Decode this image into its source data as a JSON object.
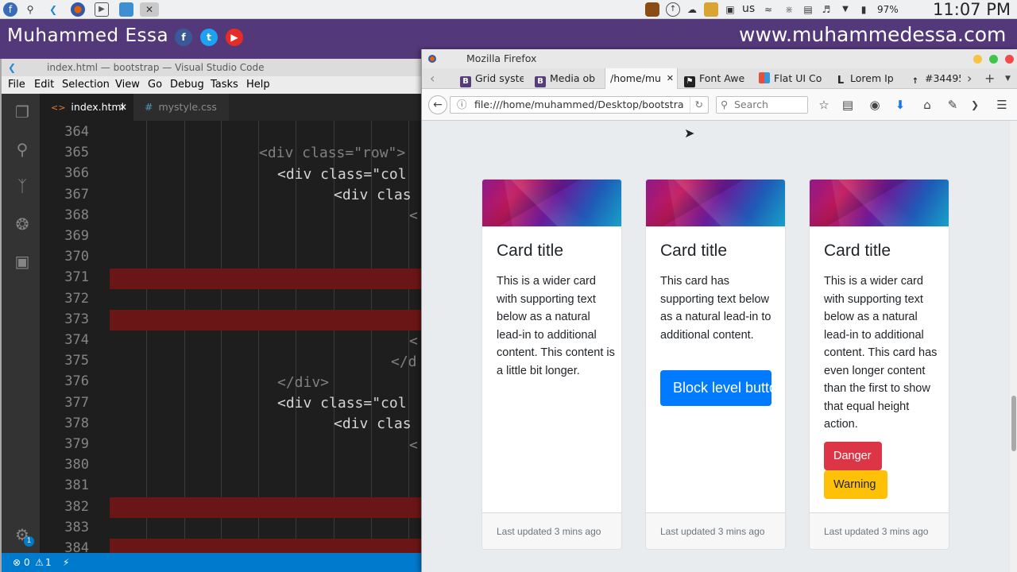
{
  "system_panel": {
    "keyboard_layout": "us",
    "battery": "97%",
    "clock": "11:07 PM"
  },
  "banner": {
    "author": "Muhammed Essa",
    "site": "www.muhammedessa.com",
    "social": [
      "f",
      "t",
      "yt"
    ]
  },
  "vscode": {
    "window_title": "index.html — bootstrap — Visual Studio Code",
    "menu": [
      "File",
      "Edit",
      "Selection",
      "View",
      "Go",
      "Debug",
      "Tasks",
      "Help"
    ],
    "tabs": [
      {
        "icon": "<>",
        "label": "index.html",
        "active": true
      },
      {
        "icon": "#",
        "label": "mystyle.css",
        "active": false
      }
    ],
    "line_numbers": [
      "364",
      "365",
      "366",
      "367",
      "368",
      "369",
      "370",
      "371",
      "372",
      "373",
      "374",
      "375",
      "376",
      "377",
      "378",
      "379",
      "380",
      "381",
      "382",
      "383",
      "384"
    ],
    "code_lines": {
      "l365": "<div class=\"row\">",
      "l366": "<div class=\"col",
      "l367": "<div clas",
      "l368": "<",
      "l374": "<",
      "l375": "</d",
      "l376": "</div>",
      "l377": "<div class=\"col",
      "l378": "<div clas",
      "l379": "<"
    },
    "status": {
      "errors": "0",
      "warnings": "1"
    },
    "settings_badge": "1"
  },
  "firefox": {
    "window_title": "Mozilla Firefox",
    "tabs": [
      {
        "label": "Grid syste"
      },
      {
        "label": "Media ob"
      },
      {
        "label": "/home/mu",
        "active": true
      },
      {
        "label": "Font Awe"
      },
      {
        "label": "Flat UI Co"
      },
      {
        "label": "Lorem Ip"
      },
      {
        "label": "#34495"
      }
    ],
    "url": "file:///home/muhammed/Desktop/bootstra",
    "search_placeholder": "Search",
    "cards": [
      {
        "title": "Card title",
        "text": "This is a wider card with supporting text below as a natural lead-in to additional content. This content is a little bit longer.",
        "footer": "Last updated 3 mins ago"
      },
      {
        "title": "Card title",
        "text": "This card has supporting text below as a natural lead-in to additional content.",
        "button": "Block level button",
        "footer": "Last updated 3 mins ago"
      },
      {
        "title": "Card title",
        "text": "This is a wider card with supporting text below as a natural lead-in to additional content. This card has even longer content than the first to show that equal height action.",
        "buttons": [
          "Danger",
          "Warning"
        ],
        "footer": "Last updated 3 mins ago"
      }
    ],
    "colors": {
      "primary": "#007bff",
      "danger": "#dc3545",
      "warning": "#ffc107"
    }
  }
}
